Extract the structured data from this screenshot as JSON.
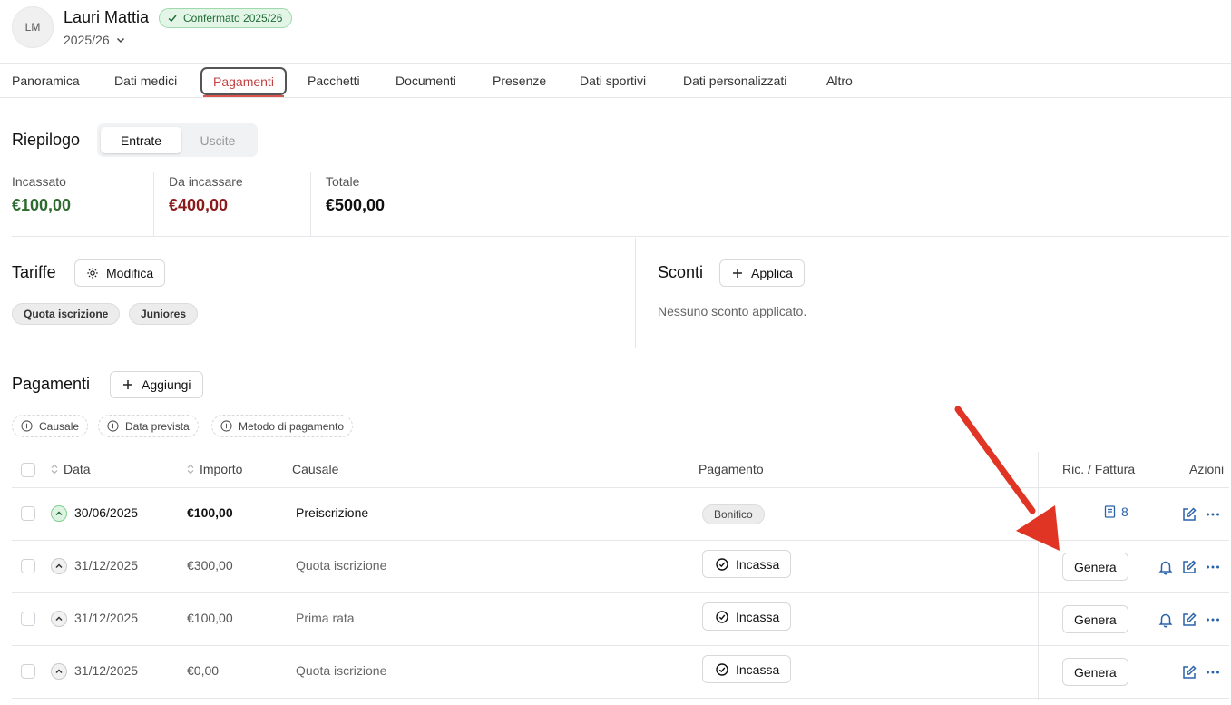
{
  "header": {
    "avatar_initials": "LM",
    "name": "Lauri Mattia",
    "status_badge": "Confermato 2025/26",
    "season": "2025/26"
  },
  "tabs": [
    {
      "label": "Panoramica",
      "active": false
    },
    {
      "label": "Dati medici",
      "active": false
    },
    {
      "label": "Pagamenti",
      "active": true
    },
    {
      "label": "Pacchetti",
      "active": false
    },
    {
      "label": "Documenti",
      "active": false
    },
    {
      "label": "Presenze",
      "active": false
    },
    {
      "label": "Dati sportivi",
      "active": false
    },
    {
      "label": "Dati personalizzati",
      "active": false
    },
    {
      "label": "Altro",
      "active": false
    }
  ],
  "summary": {
    "title": "Riepilogo",
    "toggle_in": "Entrate",
    "toggle_out": "Uscite",
    "stats": [
      {
        "label": "Incassato",
        "value": "€100,00",
        "color": "#2e6b2f"
      },
      {
        "label": "Da incassare",
        "value": "€400,00",
        "color": "#8b1a1a"
      },
      {
        "label": "Totale",
        "value": "€500,00",
        "color": "#111111"
      }
    ]
  },
  "tariffs": {
    "title": "Tariffe",
    "edit_label": "Modifica",
    "chips": [
      "Quota iscrizione",
      "Juniores"
    ]
  },
  "discounts": {
    "title": "Sconti",
    "apply_label": "Applica",
    "empty_text": "Nessuno sconto applicato."
  },
  "payments": {
    "title": "Pagamenti",
    "add_label": "Aggiungi",
    "filters": [
      "Causale",
      "Data prevista",
      "Metodo di pagamento"
    ],
    "columns": {
      "date": "Data",
      "amount": "Importo",
      "reason": "Causale",
      "payment": "Pagamento",
      "invoice": "Ric. / Fattura",
      "actions": "Azioni"
    },
    "rows": [
      {
        "date": "30/06/2025",
        "amount": "€100,00",
        "reason": "Preiscrizione",
        "paid": true,
        "method": "Bonifico",
        "receipt": "8"
      },
      {
        "date": "31/12/2025",
        "amount": "€300,00",
        "reason": "Quota iscrizione",
        "paid": false,
        "action": "Incassa",
        "invoice_action": "Genera"
      },
      {
        "date": "31/12/2025",
        "amount": "€100,00",
        "reason": "Prima rata",
        "paid": false,
        "action": "Incassa",
        "invoice_action": "Genera"
      },
      {
        "date": "31/12/2025",
        "amount": "€0,00",
        "reason": "Quota iscrizione",
        "paid": false,
        "action": "Incassa",
        "invoice_action": "Genera"
      }
    ]
  },
  "colors": {
    "accent_red": "#d9534f",
    "success_green": "#1f6b35",
    "link_blue": "#2a62a8",
    "annotation_arrow": "#e03424"
  }
}
